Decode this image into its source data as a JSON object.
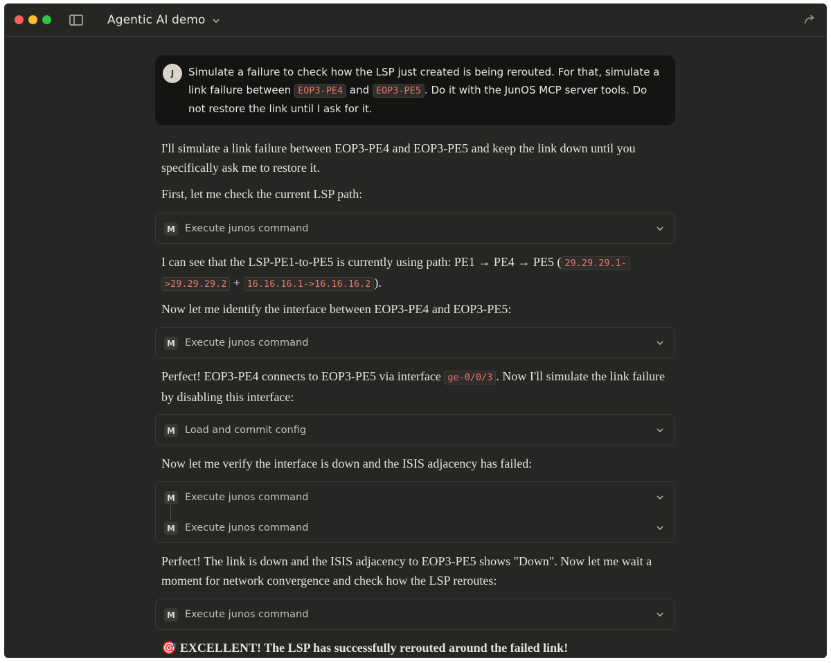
{
  "window": {
    "title": "Agentic AI demo",
    "icons": [
      "sidebar-toggle-icon",
      "chevron-down-icon",
      "share-icon"
    ]
  },
  "user_message": {
    "avatar": "J",
    "parts": [
      "Simulate a failure to check how the LSP just created is being rerouted. For that, simulate a link failure between ",
      "EOP3-PE4",
      " and ",
      "EOP3-PE5",
      ". Do it with the JunOS MCP server tools. Do not restore the link until I ask for it."
    ]
  },
  "assistant": {
    "p1": "I'll simulate a link failure between EOP3-PE4 and EOP3-PE5 and keep the link down until you specifically ask me to restore it.",
    "p2": "First, let me check the current LSP path:",
    "tool1": "Execute junos command",
    "p3": {
      "before": "I can see that the LSP-PE1-to-PE5 is currently using path: PE1 → PE4 → PE5 (",
      "code1a": "29.29.29.1-",
      "code1b": ">29.29.29.2",
      "plus": " + ",
      "code2": "16.16.16.1->16.16.16.2",
      "after": ")."
    },
    "p4": "Now let me identify the interface between EOP3-PE4 and EOP3-PE5:",
    "tool2": "Execute junos command",
    "p5": {
      "before": "Perfect! EOP3-PE4 connects to EOP3-PE5 via interface ",
      "code": "ge-0/0/3",
      "after": ". Now I'll simulate the link failure by disabling this interface:"
    },
    "tool3": "Load and commit config",
    "p6": "Now let me verify the interface is down and the ISIS adjacency has failed:",
    "tool4a": "Execute junos command",
    "tool4b": "Execute junos command",
    "p7": "Perfect! The link is down and the ISIS adjacency to EOP3-PE5 shows \"Down\". Now let me wait a moment for network convergence and check how the LSP reroutes:",
    "tool5": "Execute junos command",
    "p8": {
      "emoji": "🎯",
      "text": "EXCELLENT! The LSP has successfully rerouted around the failed link!"
    },
    "badge": "M"
  },
  "colors": {
    "background": "#262624",
    "user_bubble": "#141413",
    "code_text": "#e8786b",
    "body_text": "#e6e4dd"
  }
}
